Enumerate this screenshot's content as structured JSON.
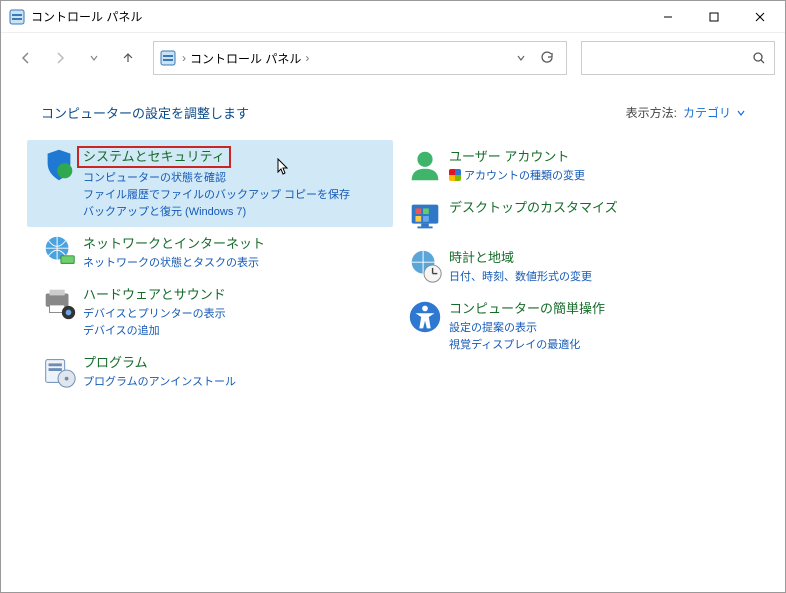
{
  "window": {
    "title": "コントロール パネル"
  },
  "breadcrumb": {
    "root": "コントロール パネル"
  },
  "search": {
    "placeholder": ""
  },
  "heading": "コンピューターの設定を調整します",
  "viewMode": {
    "label": "表示方法:",
    "value": "カテゴリ"
  },
  "left": [
    {
      "title": "システムとセキュリティ",
      "links": [
        "コンピューターの状態を確認",
        "ファイル履歴でファイルのバックアップ コピーを保存",
        "バックアップと復元 (Windows 7)"
      ]
    },
    {
      "title": "ネットワークとインターネット",
      "links": [
        "ネットワークの状態とタスクの表示"
      ]
    },
    {
      "title": "ハードウェアとサウンド",
      "links": [
        "デバイスとプリンターの表示",
        "デバイスの追加"
      ]
    },
    {
      "title": "プログラム",
      "links": [
        "プログラムのアンインストール"
      ]
    }
  ],
  "right": [
    {
      "title": "ユーザー アカウント",
      "links": [
        "アカウントの種類の変更"
      ],
      "shield": true
    },
    {
      "title": "デスクトップのカスタマイズ",
      "links": []
    },
    {
      "title": "時計と地域",
      "links": [
        "日付、時刻、数値形式の変更"
      ]
    },
    {
      "title": "コンピューターの簡単操作",
      "links": [
        "設定の提案の表示",
        "視覚ディスプレイの最適化"
      ]
    }
  ]
}
